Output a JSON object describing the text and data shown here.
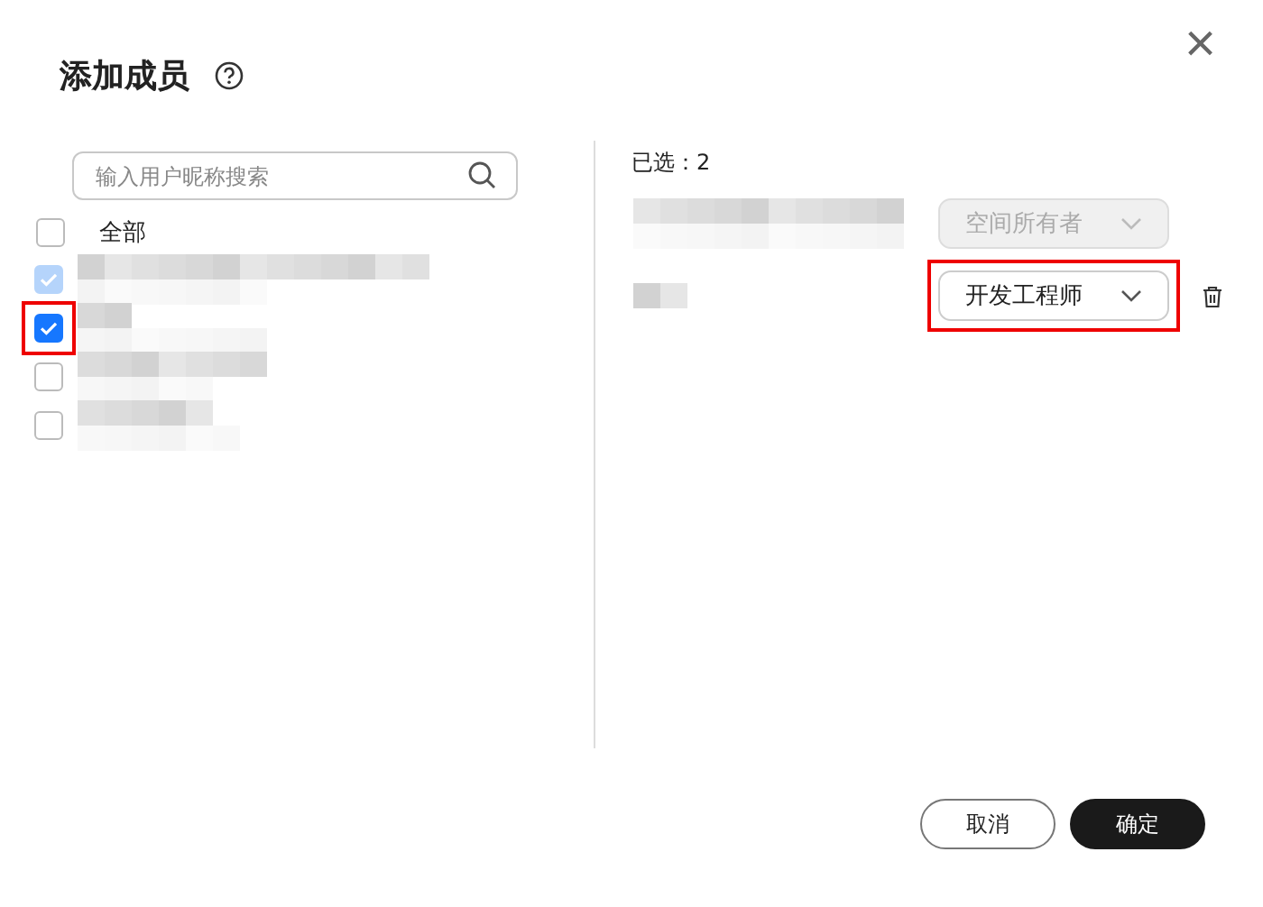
{
  "dialog": {
    "title": "添加成员",
    "close": "×"
  },
  "search": {
    "placeholder": "输入用户昵称搜索"
  },
  "select_all": {
    "label": "全部",
    "checked": false
  },
  "members": [
    {
      "checked": true,
      "disabled": true,
      "highlighted": false
    },
    {
      "checked": true,
      "disabled": false,
      "highlighted": true
    },
    {
      "checked": false,
      "disabled": false,
      "highlighted": false
    },
    {
      "checked": false,
      "disabled": false,
      "highlighted": false
    }
  ],
  "selected_count": "已选：2",
  "selected": [
    {
      "role": "空间所有者",
      "disabled": true,
      "highlighted": false,
      "removable": false
    },
    {
      "role": "开发工程师",
      "disabled": false,
      "highlighted": true,
      "removable": true
    }
  ],
  "buttons": [
    {
      "label": "取消",
      "kind": "secondary"
    },
    {
      "label": "确定",
      "kind": "primary"
    }
  ]
}
